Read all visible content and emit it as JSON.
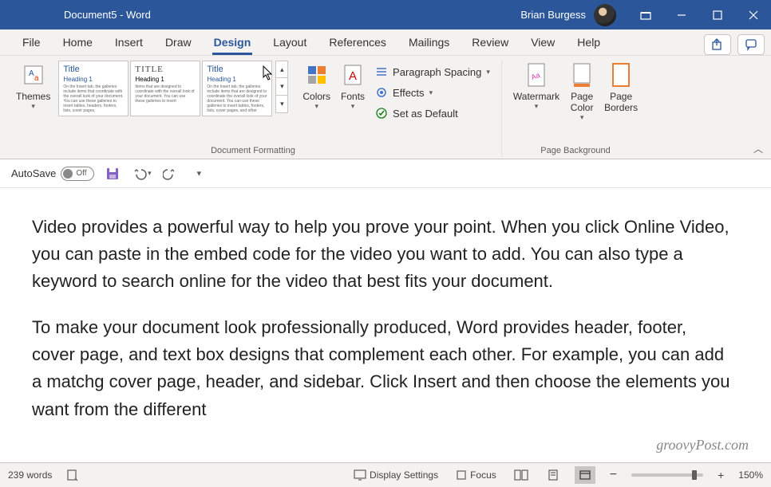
{
  "titlebar": {
    "doc_title": "Document5  -  Word",
    "user": "Brian Burgess"
  },
  "tabs": {
    "items": [
      "File",
      "Home",
      "Insert",
      "Draw",
      "Design",
      "Layout",
      "References",
      "Mailings",
      "Review",
      "View",
      "Help"
    ],
    "active_index": 4
  },
  "ribbon": {
    "themes_label": "Themes",
    "gallery": [
      {
        "title": "Title",
        "heading": "Heading 1"
      },
      {
        "title": "TITLE",
        "heading": "Heading 1"
      },
      {
        "title": "Title",
        "heading": "Heading 1"
      }
    ],
    "colors_label": "Colors",
    "fonts_label": "Fonts",
    "paragraph_spacing": "Paragraph Spacing",
    "effects": "Effects",
    "set_default": "Set as Default",
    "doc_formatting_label": "Document Formatting",
    "watermark_label": "Watermark",
    "page_color_label": "Page\nColor",
    "page_borders_label": "Page\nBorders",
    "page_background_label": "Page Background"
  },
  "qat": {
    "autosave_label": "AutoSave",
    "autosave_state": "Off"
  },
  "document": {
    "p1": "Video provides a powerful way to help you prove your point. When you click Online Video, you can paste in the embed code for the video you want to add. You can also type a keyword to search online for the video that best fits your document.",
    "p2": "To make your document look professionally produced, Word provides header, footer, cover page, and text box designs that complement each other. For example, you can add a matchg cover page, header, and sidebar. Click Insert and then choose the elements you want from the different"
  },
  "statusbar": {
    "word_count": "239 words",
    "display_settings": "Display Settings",
    "focus": "Focus",
    "zoom": "150%"
  },
  "watermark_text": "groovyPost.com"
}
